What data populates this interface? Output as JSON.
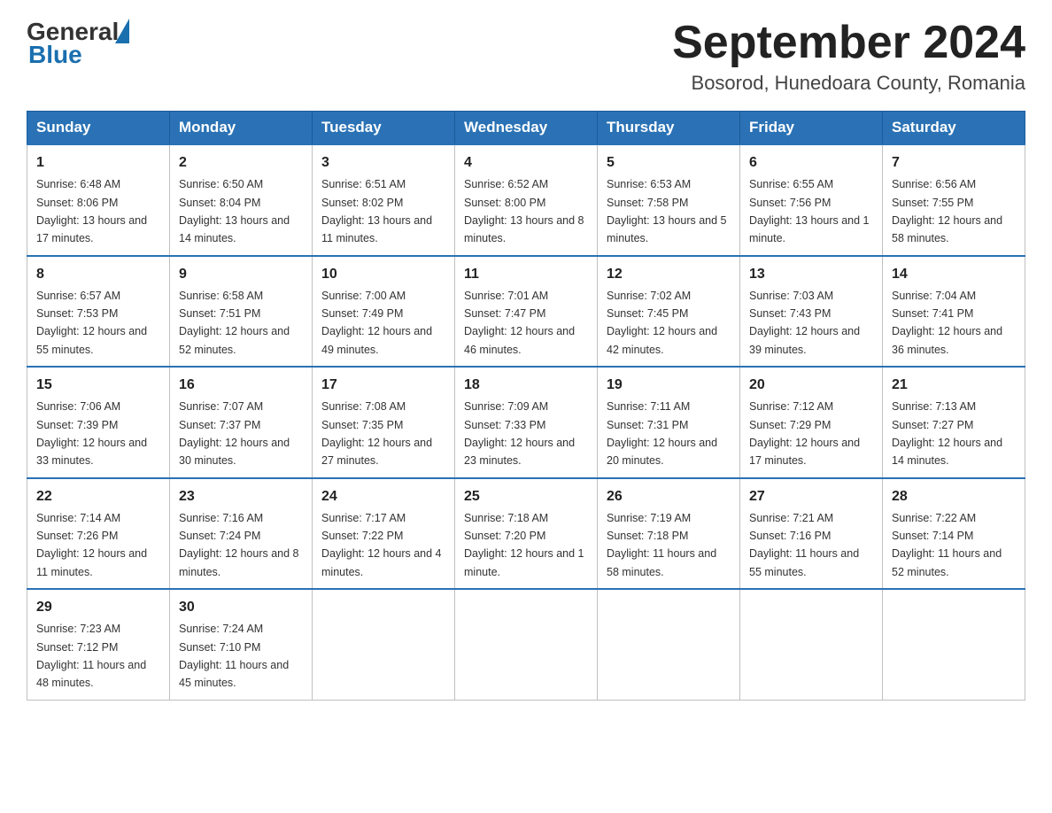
{
  "header": {
    "logo_general": "General",
    "logo_blue": "Blue",
    "month_year": "September 2024",
    "location": "Bosorod, Hunedoara County, Romania"
  },
  "days_of_week": [
    "Sunday",
    "Monday",
    "Tuesday",
    "Wednesday",
    "Thursday",
    "Friday",
    "Saturday"
  ],
  "weeks": [
    [
      {
        "day": "1",
        "sunrise": "6:48 AM",
        "sunset": "8:06 PM",
        "daylight": "13 hours and 17 minutes."
      },
      {
        "day": "2",
        "sunrise": "6:50 AM",
        "sunset": "8:04 PM",
        "daylight": "13 hours and 14 minutes."
      },
      {
        "day": "3",
        "sunrise": "6:51 AM",
        "sunset": "8:02 PM",
        "daylight": "13 hours and 11 minutes."
      },
      {
        "day": "4",
        "sunrise": "6:52 AM",
        "sunset": "8:00 PM",
        "daylight": "13 hours and 8 minutes."
      },
      {
        "day": "5",
        "sunrise": "6:53 AM",
        "sunset": "7:58 PM",
        "daylight": "13 hours and 5 minutes."
      },
      {
        "day": "6",
        "sunrise": "6:55 AM",
        "sunset": "7:56 PM",
        "daylight": "13 hours and 1 minute."
      },
      {
        "day": "7",
        "sunrise": "6:56 AM",
        "sunset": "7:55 PM",
        "daylight": "12 hours and 58 minutes."
      }
    ],
    [
      {
        "day": "8",
        "sunrise": "6:57 AM",
        "sunset": "7:53 PM",
        "daylight": "12 hours and 55 minutes."
      },
      {
        "day": "9",
        "sunrise": "6:58 AM",
        "sunset": "7:51 PM",
        "daylight": "12 hours and 52 minutes."
      },
      {
        "day": "10",
        "sunrise": "7:00 AM",
        "sunset": "7:49 PM",
        "daylight": "12 hours and 49 minutes."
      },
      {
        "day": "11",
        "sunrise": "7:01 AM",
        "sunset": "7:47 PM",
        "daylight": "12 hours and 46 minutes."
      },
      {
        "day": "12",
        "sunrise": "7:02 AM",
        "sunset": "7:45 PM",
        "daylight": "12 hours and 42 minutes."
      },
      {
        "day": "13",
        "sunrise": "7:03 AM",
        "sunset": "7:43 PM",
        "daylight": "12 hours and 39 minutes."
      },
      {
        "day": "14",
        "sunrise": "7:04 AM",
        "sunset": "7:41 PM",
        "daylight": "12 hours and 36 minutes."
      }
    ],
    [
      {
        "day": "15",
        "sunrise": "7:06 AM",
        "sunset": "7:39 PM",
        "daylight": "12 hours and 33 minutes."
      },
      {
        "day": "16",
        "sunrise": "7:07 AM",
        "sunset": "7:37 PM",
        "daylight": "12 hours and 30 minutes."
      },
      {
        "day": "17",
        "sunrise": "7:08 AM",
        "sunset": "7:35 PM",
        "daylight": "12 hours and 27 minutes."
      },
      {
        "day": "18",
        "sunrise": "7:09 AM",
        "sunset": "7:33 PM",
        "daylight": "12 hours and 23 minutes."
      },
      {
        "day": "19",
        "sunrise": "7:11 AM",
        "sunset": "7:31 PM",
        "daylight": "12 hours and 20 minutes."
      },
      {
        "day": "20",
        "sunrise": "7:12 AM",
        "sunset": "7:29 PM",
        "daylight": "12 hours and 17 minutes."
      },
      {
        "day": "21",
        "sunrise": "7:13 AM",
        "sunset": "7:27 PM",
        "daylight": "12 hours and 14 minutes."
      }
    ],
    [
      {
        "day": "22",
        "sunrise": "7:14 AM",
        "sunset": "7:26 PM",
        "daylight": "12 hours and 11 minutes."
      },
      {
        "day": "23",
        "sunrise": "7:16 AM",
        "sunset": "7:24 PM",
        "daylight": "12 hours and 8 minutes."
      },
      {
        "day": "24",
        "sunrise": "7:17 AM",
        "sunset": "7:22 PM",
        "daylight": "12 hours and 4 minutes."
      },
      {
        "day": "25",
        "sunrise": "7:18 AM",
        "sunset": "7:20 PM",
        "daylight": "12 hours and 1 minute."
      },
      {
        "day": "26",
        "sunrise": "7:19 AM",
        "sunset": "7:18 PM",
        "daylight": "11 hours and 58 minutes."
      },
      {
        "day": "27",
        "sunrise": "7:21 AM",
        "sunset": "7:16 PM",
        "daylight": "11 hours and 55 minutes."
      },
      {
        "day": "28",
        "sunrise": "7:22 AM",
        "sunset": "7:14 PM",
        "daylight": "11 hours and 52 minutes."
      }
    ],
    [
      {
        "day": "29",
        "sunrise": "7:23 AM",
        "sunset": "7:12 PM",
        "daylight": "11 hours and 48 minutes."
      },
      {
        "day": "30",
        "sunrise": "7:24 AM",
        "sunset": "7:10 PM",
        "daylight": "11 hours and 45 minutes."
      },
      null,
      null,
      null,
      null,
      null
    ]
  ]
}
